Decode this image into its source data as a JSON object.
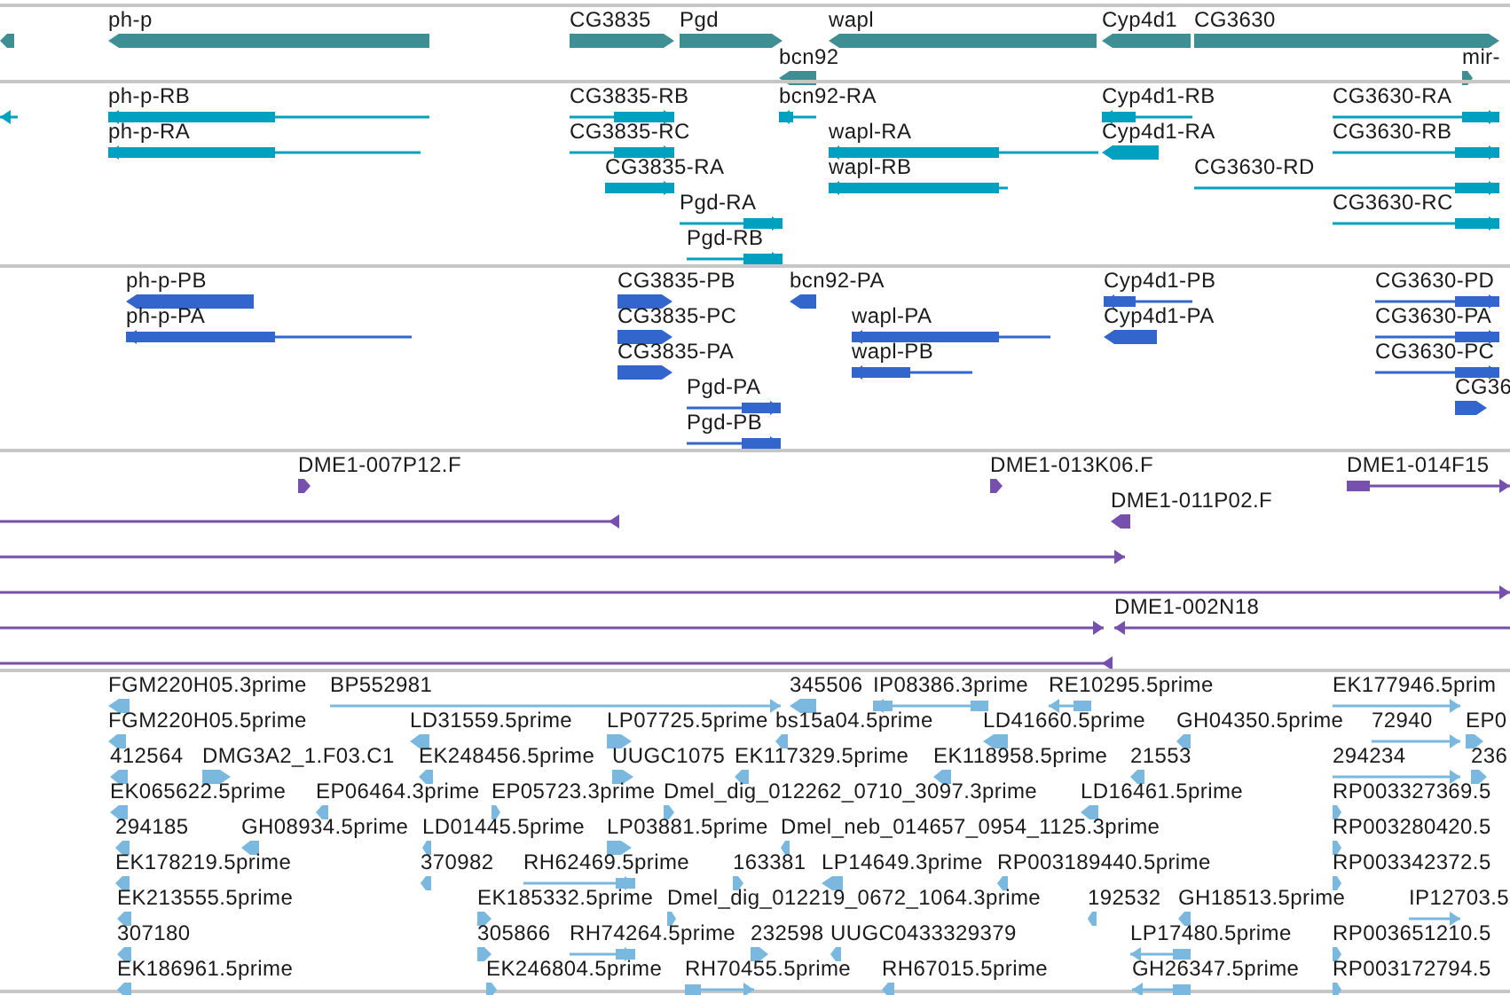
{
  "tracks": [
    {
      "kind": "gene",
      "features": [
        {
          "reverse": true
        },
        {
          "label": "ph-p",
          "reverse": true
        },
        {
          "label": "CG3835",
          "reverse": false
        },
        {
          "label": "Pgd",
          "reverse": false
        },
        {
          "label": "bcn92",
          "reverse": true
        },
        {
          "label": "wapl",
          "reverse": true
        },
        {
          "label": "Cyp4d1",
          "reverse": true
        },
        {
          "label": "CG3630",
          "reverse": false
        },
        {
          "label": "mir-",
          "reverse": false
        }
      ]
    },
    {
      "kind": "transcript",
      "features": [
        {
          "reverse": true
        },
        {
          "label": "ph-p-RB",
          "reverse": true
        },
        {
          "label": "ph-p-RA",
          "reverse": true
        },
        {
          "label": "CG3835-RB",
          "reverse": false
        },
        {
          "label": "CG3835-RC",
          "reverse": false
        },
        {
          "label": "CG3835-RA",
          "reverse": false
        },
        {
          "label": "Pgd-RA",
          "reverse": false
        },
        {
          "label": "Pgd-RB",
          "reverse": false
        },
        {
          "label": "bcn92-RA",
          "reverse": true
        },
        {
          "label": "wapl-RA",
          "reverse": true
        },
        {
          "label": "wapl-RB",
          "reverse": true
        },
        {
          "label": "Cyp4d1-RB",
          "reverse": true
        },
        {
          "label": "Cyp4d1-RA",
          "reverse": true
        },
        {
          "label": "CG3630-RA",
          "reverse": false
        },
        {
          "label": "CG3630-RB",
          "reverse": false
        },
        {
          "label": "CG3630-RD",
          "reverse": false
        },
        {
          "label": "CG3630-RC",
          "reverse": false
        }
      ]
    },
    {
      "kind": "protein",
      "features": [
        {
          "label": "ph-p-PB",
          "reverse": true
        },
        {
          "label": "ph-p-PA",
          "reverse": true
        },
        {
          "label": "CG3835-PB",
          "reverse": false
        },
        {
          "label": "CG3835-PC",
          "reverse": false
        },
        {
          "label": "CG3835-PA",
          "reverse": false
        },
        {
          "label": "Pgd-PA",
          "reverse": false
        },
        {
          "label": "Pgd-PB",
          "reverse": false
        },
        {
          "label": "bcn92-PA",
          "reverse": true
        },
        {
          "label": "wapl-PA",
          "reverse": true
        },
        {
          "label": "wapl-PB",
          "reverse": true
        },
        {
          "label": "Cyp4d1-PB",
          "reverse": true
        },
        {
          "label": "Cyp4d1-PA",
          "reverse": true
        },
        {
          "label": "CG3630-PD",
          "reverse": false
        },
        {
          "label": "CG3630-PA",
          "reverse": false
        },
        {
          "label": "CG3630-PC",
          "reverse": false
        },
        {
          "label": "CG36",
          "reverse": false
        }
      ]
    },
    {
      "kind": "clone",
      "features": [
        {
          "label": "DME1-007P12.F",
          "reverse": false
        },
        {
          "reverse": true
        },
        {
          "label": "DME1-013K06.F",
          "reverse": false
        },
        {
          "label": "DME1-014F15",
          "reverse": false
        },
        {
          "label": "DME1-011P02.F",
          "reverse": true
        },
        {
          "reverse": false
        },
        {
          "reverse": false
        },
        {
          "reverse": false
        },
        {
          "label": "DME1-002N18",
          "reverse": true
        },
        {
          "reverse": true
        }
      ]
    },
    {
      "kind": "est",
      "features": [
        {
          "label": "FGM220H05.3prime",
          "reverse": true
        },
        {
          "label": "BP552981",
          "reverse": false
        },
        {
          "label": "345506",
          "reverse": true
        },
        {
          "label": "IP08386.3prime",
          "reverse": true
        },
        {
          "label": "RE10295.5prime",
          "reverse": true
        },
        {
          "label": "EK177946.5prim",
          "reverse": false
        },
        {
          "label": "FGM220H05.5prime",
          "reverse": true
        },
        {
          "label": "LD31559.5prime",
          "reverse": true
        },
        {
          "label": "LP07725.5prime",
          "reverse": false
        },
        {
          "label": "bs15a04.5prime",
          "reverse": true
        },
        {
          "label": "LD41660.5prime",
          "reverse": true
        },
        {
          "label": "GH04350.5prime",
          "reverse": true
        },
        {
          "label": "72940",
          "reverse": false
        },
        {
          "label": "EP0",
          "reverse": false
        },
        {
          "label": "412564",
          "reverse": true
        },
        {
          "label": "DMG3A2_1.F03.C1",
          "reverse": false
        },
        {
          "label": "EK248456.5prime",
          "reverse": true
        },
        {
          "label": "UUGC1075",
          "reverse": false
        },
        {
          "label": "EK117329.5prime",
          "reverse": true
        },
        {
          "label": "EK118958.5prime",
          "reverse": true
        },
        {
          "label": "21553",
          "reverse": true
        },
        {
          "label": "294234",
          "reverse": false
        },
        {
          "label": "236",
          "reverse": false
        },
        {
          "label": "EK065622.5prime",
          "reverse": true
        },
        {
          "label": "EP06464.3prime",
          "reverse": true
        },
        {
          "label": "EP05723.3prime",
          "reverse": false
        },
        {
          "label": "Dmel_dig_012262_0710_3097.3prime",
          "reverse": false
        },
        {
          "label": "LD16461.5prime",
          "reverse": true
        },
        {
          "label": "RP003327369.5",
          "reverse": false
        },
        {
          "label": "294185",
          "reverse": true
        },
        {
          "label": "GH08934.5prime",
          "reverse": true
        },
        {
          "label": "LD01445.5prime",
          "reverse": true
        },
        {
          "label": "LP03881.5prime",
          "reverse": false
        },
        {
          "label": "Dmel_neb_014657_0954_1125.3prime",
          "reverse": true
        },
        {
          "label": "RP003280420.5",
          "reverse": false
        },
        {
          "label": "EK178219.5prime",
          "reverse": true
        },
        {
          "label": "370982",
          "reverse": true
        },
        {
          "label": "RH62469.5prime",
          "reverse": false
        },
        {
          "label": "163381",
          "reverse": false
        },
        {
          "label": "LP14649.3prime",
          "reverse": true
        },
        {
          "label": "RP003189440.5prime",
          "reverse": true
        },
        {
          "label": "RP003342372.5",
          "reverse": false
        },
        {
          "label": "EK213555.5prime",
          "reverse": true
        },
        {
          "label": "EK185332.5prime",
          "reverse": false
        },
        {
          "label": "Dmel_dig_012219_0672_1064.3prime",
          "reverse": false
        },
        {
          "label": "192532",
          "reverse": true
        },
        {
          "label": "GH18513.5prime",
          "reverse": true
        },
        {
          "label": "IP12703.5",
          "reverse": false
        },
        {
          "label": "307180",
          "reverse": true
        },
        {
          "label": "305866",
          "reverse": false
        },
        {
          "label": "RH74264.5prime",
          "reverse": false
        },
        {
          "label": "232598",
          "reverse": false
        },
        {
          "label": "UUGC0433329379",
          "reverse": true
        },
        {
          "label": "LP17480.5prime",
          "reverse": true
        },
        {
          "label": "RP003651210.5",
          "reverse": false
        },
        {
          "label": "EK186961.5prime",
          "reverse": true
        },
        {
          "label": "EK246804.5prime",
          "reverse": false
        },
        {
          "label": "RH70455.5prime",
          "reverse": false
        },
        {
          "label": "RH67015.5prime",
          "reverse": true
        },
        {
          "label": "GH26347.5prime",
          "reverse": true
        },
        {
          "label": "RP003172794.5",
          "reverse": false
        }
      ]
    }
  ]
}
